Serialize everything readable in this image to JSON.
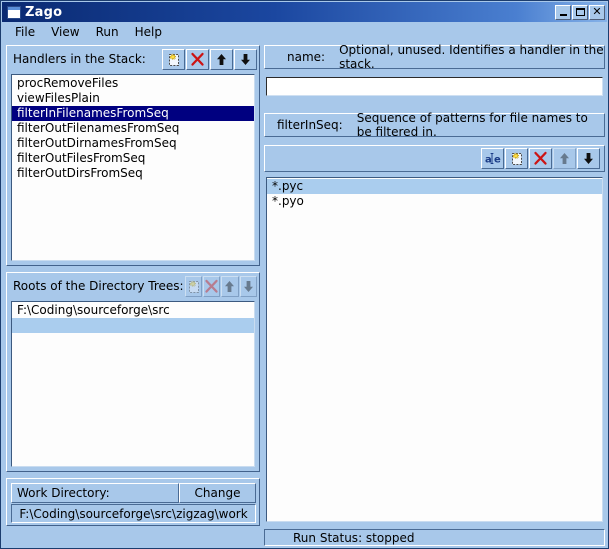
{
  "window": {
    "title": "Zago",
    "icon": "app-window-icon",
    "controls": {
      "minimize": "minimize-icon",
      "maximize": "maximize-icon",
      "close": "close-icon"
    }
  },
  "menu": {
    "items": [
      {
        "label": "File"
      },
      {
        "label": "View"
      },
      {
        "label": "Run"
      },
      {
        "label": "Help"
      }
    ]
  },
  "handlers_group": {
    "title": "Handlers in the Stack:",
    "toolbar": [
      {
        "name": "new-handler-button",
        "icon": "new-page-icon",
        "enabled": true
      },
      {
        "name": "delete-handler-button",
        "icon": "delete-x-icon",
        "enabled": true
      },
      {
        "name": "move-handler-up-button",
        "icon": "arrow-up-icon",
        "enabled": true
      },
      {
        "name": "move-handler-down-button",
        "icon": "arrow-down-icon",
        "enabled": true
      }
    ],
    "items": [
      {
        "label": "procRemoveFiles",
        "selected": false
      },
      {
        "label": "viewFilesPlain",
        "selected": false
      },
      {
        "label": "filterInFilenamesFromSeq",
        "selected": true
      },
      {
        "label": "filterOutFilenamesFromSeq",
        "selected": false
      },
      {
        "label": "filterOutDirnamesFromSeq",
        "selected": false
      },
      {
        "label": "filterOutFilesFromSeq",
        "selected": false
      },
      {
        "label": "filterOutDirsFromSeq",
        "selected": false
      }
    ]
  },
  "roots_group": {
    "title": "Roots of the Directory Trees:",
    "toolbar": [
      {
        "name": "new-root-button",
        "icon": "new-page-icon",
        "enabled": false
      },
      {
        "name": "delete-root-button",
        "icon": "delete-x-icon",
        "enabled": false
      },
      {
        "name": "move-root-up-button",
        "icon": "arrow-up-icon",
        "enabled": false
      },
      {
        "name": "move-root-down-button",
        "icon": "arrow-down-icon",
        "enabled": false
      }
    ],
    "items": [
      {
        "label": "F:\\Coding\\sourceforge\\src",
        "selected": false
      },
      {
        "label": "",
        "selected": true
      }
    ]
  },
  "work_directory": {
    "label": "Work Directory:",
    "change_button": "Change",
    "path": "F:\\Coding\\sourceforge\\src\\zigzag\\work"
  },
  "detail": {
    "name_field": {
      "key": "name:",
      "description": "Optional, unused.  Identifies a handler in the stack.",
      "value": "",
      "placeholder": ""
    },
    "seq_field": {
      "key": "filterInSeq:",
      "description": "Sequence of patterns for file names to be filtered in."
    },
    "seq_toolbar": [
      {
        "name": "edit-pattern-button",
        "icon": "text-edit-icon",
        "enabled": true
      },
      {
        "name": "new-pattern-button",
        "icon": "new-page-icon",
        "enabled": true
      },
      {
        "name": "delete-pattern-button",
        "icon": "delete-x-icon",
        "enabled": true
      },
      {
        "name": "move-pattern-up-button",
        "icon": "arrow-up-icon",
        "enabled": false
      },
      {
        "name": "move-pattern-down-button",
        "icon": "arrow-down-icon",
        "enabled": true
      }
    ],
    "seq_items": [
      {
        "label": "*.pyc",
        "selected": true
      },
      {
        "label": "*.pyo",
        "selected": false
      }
    ]
  },
  "status_bar": {
    "text": "Run Status: stopped"
  },
  "colors": {
    "face": "#a8c8ea",
    "title_start": "#0a2a72",
    "title_end": "#86b2e8",
    "selection_focus": "#000080",
    "selection_blur": "#aacdee",
    "delete_red": "#cc1414",
    "list_bg": "#fdfdfd"
  }
}
